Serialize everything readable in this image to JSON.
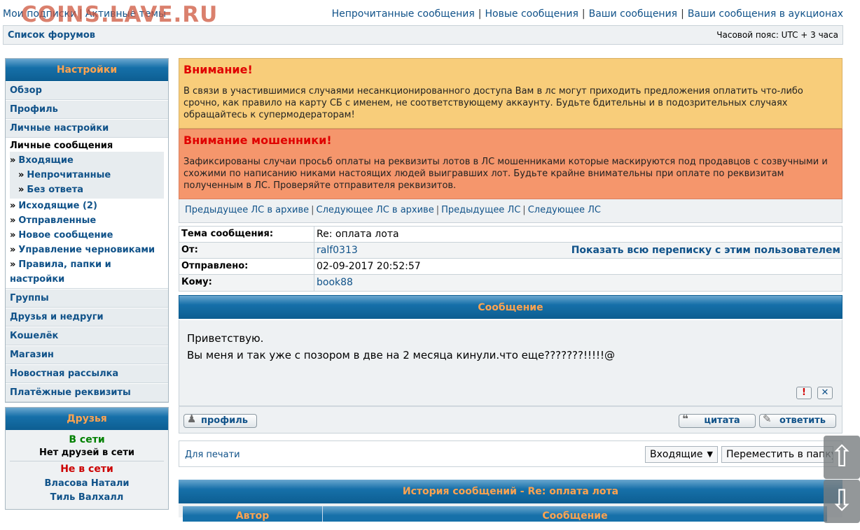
{
  "top": {
    "left_links": [
      "Мои подписки",
      "Активные темы"
    ],
    "watermark": "COINS.LAVE.RU",
    "right_links": [
      "Непрочитанные сообщения",
      "Новые сообщения",
      "Ваши сообщения",
      "Ваши сообщения в аукционах"
    ]
  },
  "navbar": {
    "forums": "Список форумов",
    "timezone": "Часовой пояс: UTC + 3 часа"
  },
  "sidebar": {
    "settings_title": "Настройки",
    "items_top": [
      "Обзор",
      "Профиль",
      "Личные настройки"
    ],
    "pm_title": "Личные сообщения",
    "inbox": "Входящие",
    "unread": "Непрочитанные",
    "no_reply": "Без ответа",
    "outbox": "Исходящие (2)",
    "sent": "Отправленные",
    "new_msg": "Новое сообщение",
    "drafts": "Управление черновиками",
    "rules": "Правила, папки и",
    "rules2": "настройки",
    "items_bottom": [
      "Группы",
      "Друзья и недруги",
      "Кошелёк",
      "Магазин",
      "Новостная рассылка",
      "Платёжные реквизиты"
    ],
    "raquo": "»"
  },
  "friends": {
    "title": "Друзья",
    "online": "В сети",
    "no_online": "Нет друзей в сети",
    "offline": "Не в сети",
    "list": [
      "Власова Натали",
      "Тиль Валхалл"
    ]
  },
  "warning1": {
    "title": "Внимание!",
    "text": "В связи в участившимися случаями несанкционированного доступа Вам в лс могут приходить предложения оплатить что-либо срочно, как правило на карту СБ с именем, не соответствующему аккаунту. Будьте бдительны и в подозрительных случаях обращайтесь к супермодераторам!"
  },
  "warning2": {
    "title": "Внимание мошенники!",
    "text": "Зафиксированы случаи просьб оплаты на реквизиты лотов в ЛС мошенниками которые маскируются под продавцов с созвучными и схожими по написанию никами настоящих людей выигравших лот. Будьте крайне внимательны при оплате по реквизитам полученным в ЛС. Проверяйте отправителя реквизитов."
  },
  "pm_nav": [
    "Предыдущее ЛС в архиве",
    "Следующее ЛС в архиве",
    "Предыдущее ЛС",
    "Следующее ЛС"
  ],
  "headers": {
    "subject_label": "Тема сообщения:",
    "subject": "Re: оплата лота",
    "from_label": "От:",
    "from": "ralf0313",
    "show_all": "Показать всю переписку с этим пользователем",
    "sent_label": "Отправлено:",
    "sent": "02-09-2017 20:52:57",
    "to_label": "Кому:",
    "to": "book88"
  },
  "message": {
    "title": "Сообщение",
    "line1": "Приветствую.",
    "line2": "Вы меня и так уже с позором в две на 2 месяца кинули.что еще???????!!!!!@",
    "report_icon": "!",
    "delete_icon": "✕"
  },
  "actions": {
    "profile": "профиль",
    "quote": "цитата",
    "reply": "ответить"
  },
  "print_bar": {
    "print": "Для печати",
    "folder": "Входящие",
    "move": "Переместить в папку"
  },
  "history": {
    "title": "История сообщений - Re: оплата лота",
    "col_author": "Автор",
    "col_message": "Сообщение"
  },
  "scroll": {
    "up": "⇧",
    "down": "⇩"
  }
}
